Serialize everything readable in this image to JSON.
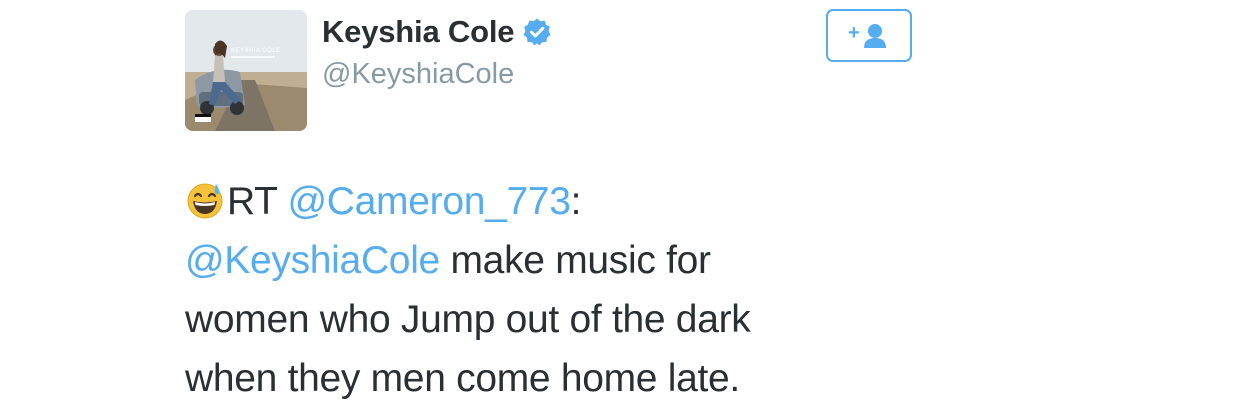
{
  "user": {
    "display_name": "Keyshia Cole",
    "handle": "@KeyshiaCole",
    "verified_icon": "verified-badge-icon",
    "avatar_icon": "album-cover-avatar",
    "avatar_cover_text": "KEYSHIA COLE"
  },
  "follow_button": {
    "icon": "add-user-icon",
    "plus": "+"
  },
  "tweet": {
    "emoji_icon": "grinning-sweat-emoji-icon",
    "rt_prefix": "RT ",
    "rt_mention": "@Cameron_773",
    "rt_colon": ":",
    "mention": "@KeyshiaCole",
    "line2_rest": " make music for",
    "line3": "women who Jump out of the dark",
    "line4": "when they men come home late."
  },
  "colors": {
    "link": "#55acee",
    "text": "#292f33",
    "secondary": "#8899a6"
  }
}
